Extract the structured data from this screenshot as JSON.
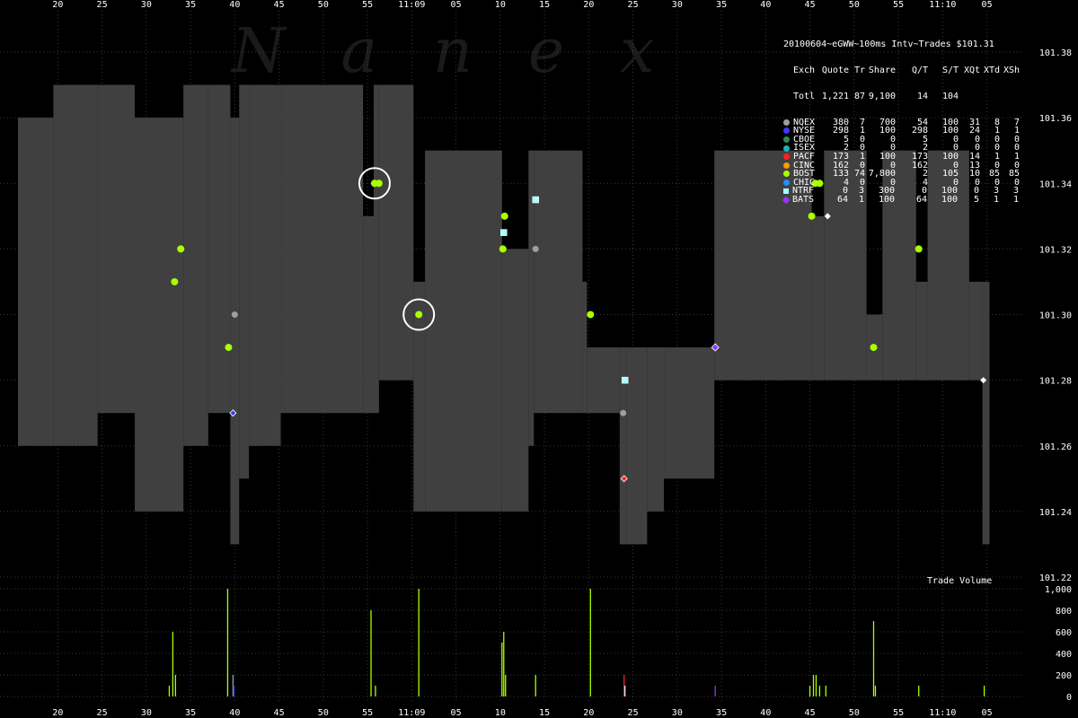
{
  "watermark": "Nanex",
  "legend": {
    "title": "20100604~eGWW~100ms Intv~Trades $101.31",
    "header": [
      "Exch",
      "Quote",
      "Tr",
      "Share",
      "Q/T",
      "S/T",
      "XQt",
      "XTd",
      "XSh"
    ],
    "total": [
      "Totl",
      "1,221",
      "87",
      "9,100",
      "14",
      "104",
      "",
      "",
      ""
    ],
    "rows": [
      {
        "exch": "NQEX",
        "quote": "380",
        "tr": "7",
        "share": "700",
        "qt": "54",
        "st": "100",
        "xqt": "31",
        "xtd": "8",
        "xsh": "7",
        "color": "#9e9e9e",
        "marker": "dot"
      },
      {
        "exch": "NYSE",
        "quote": "298",
        "tr": "1",
        "share": "100",
        "qt": "298",
        "st": "100",
        "xqt": "24",
        "xtd": "1",
        "xsh": "1",
        "color": "#3a3aff",
        "marker": "dot"
      },
      {
        "exch": "CBOE",
        "quote": "5",
        "tr": "0",
        "share": "0",
        "qt": "5",
        "st": "0",
        "xqt": "0",
        "xtd": "0",
        "xsh": "0",
        "color": "#2e8b57",
        "marker": "dot"
      },
      {
        "exch": "ISEX",
        "quote": "2",
        "tr": "0",
        "share": "0",
        "qt": "2",
        "st": "0",
        "xqt": "0",
        "xtd": "0",
        "xsh": "0",
        "color": "#20b2aa",
        "marker": "dot"
      },
      {
        "exch": "PACF",
        "quote": "173",
        "tr": "1",
        "share": "100",
        "qt": "173",
        "st": "100",
        "xqt": "14",
        "xtd": "1",
        "xsh": "1",
        "color": "#ff2020",
        "marker": "dot"
      },
      {
        "exch": "CINC",
        "quote": "162",
        "tr": "0",
        "share": "0",
        "qt": "162",
        "st": "0",
        "xqt": "13",
        "xtd": "0",
        "xsh": "0",
        "color": "#ff9900",
        "marker": "dot"
      },
      {
        "exch": "BOST",
        "quote": "133",
        "tr": "74",
        "share": "7,800",
        "qt": "2",
        "st": "105",
        "xqt": "10",
        "xtd": "85",
        "xsh": "85",
        "color": "#aaff00",
        "marker": "dot"
      },
      {
        "exch": "CHIC",
        "quote": "4",
        "tr": "0",
        "share": "0",
        "qt": "4",
        "st": "0",
        "xqt": "0",
        "xtd": "0",
        "xsh": "0",
        "color": "#1e90ff",
        "marker": "dot"
      },
      {
        "exch": "NTRF",
        "quote": "0",
        "tr": "3",
        "share": "300",
        "qt": "0",
        "st": "100",
        "xqt": "0",
        "xtd": "3",
        "xsh": "3",
        "color": "#aaffff",
        "marker": "square"
      },
      {
        "exch": "BATS",
        "quote": "64",
        "tr": "1",
        "share": "100",
        "qt": "64",
        "st": "100",
        "xqt": "5",
        "xtd": "1",
        "xsh": "1",
        "color": "#9933ff",
        "marker": "diamond"
      }
    ]
  },
  "volume_label": "Trade Volume",
  "colors": {
    "band": "#404040",
    "grid": "#3a3a3a",
    "bost": "#aaff00",
    "nqex": "#9e9e9e",
    "ntrf": "#aaffff",
    "bats": "#9933ff",
    "pacf": "#ff2020",
    "nyse": "#3a3aff",
    "white": "#ffffff"
  },
  "chart_data": [
    {
      "type": "area",
      "description_kind": "price",
      "x_unit": "seconds from 11:08:20",
      "x_ticks": [
        {
          "t": 0,
          "label": "20"
        },
        {
          "t": 5,
          "label": "25"
        },
        {
          "t": 10,
          "label": "30"
        },
        {
          "t": 15,
          "label": "35"
        },
        {
          "t": 20,
          "label": "40"
        },
        {
          "t": 25,
          "label": "45"
        },
        {
          "t": 30,
          "label": "50"
        },
        {
          "t": 35,
          "label": "55"
        },
        {
          "t": 40,
          "label": "11:09"
        },
        {
          "t": 45,
          "label": "05"
        },
        {
          "t": 50,
          "label": "10"
        },
        {
          "t": 55,
          "label": "15"
        },
        {
          "t": 60,
          "label": "20"
        },
        {
          "t": 65,
          "label": "25"
        },
        {
          "t": 70,
          "label": "30"
        },
        {
          "t": 75,
          "label": "35"
        },
        {
          "t": 80,
          "label": "40"
        },
        {
          "t": 85,
          "label": "45"
        },
        {
          "t": 90,
          "label": "50"
        },
        {
          "t": 95,
          "label": "55"
        },
        {
          "t": 100,
          "label": "11:10"
        },
        {
          "t": 105,
          "label": "05"
        }
      ],
      "x_range": [
        -4.5,
        106
      ],
      "y_ticks": [
        "101.22",
        "101.24",
        "101.26",
        "101.28",
        "101.30",
        "101.32",
        "101.34",
        "101.36",
        "101.38"
      ],
      "y_range": [
        101.22,
        101.38
      ],
      "band": [
        {
          "t0": -4.5,
          "t1": -0.5,
          "bid": 101.26,
          "ask": 101.36
        },
        {
          "t0": -0.5,
          "t1": 4.5,
          "bid": 101.26,
          "ask": 101.37
        },
        {
          "t0": 4.5,
          "t1": 8.7,
          "bid": 101.27,
          "ask": 101.37
        },
        {
          "t0": 8.7,
          "t1": 14.2,
          "bid": 101.24,
          "ask": 101.36
        },
        {
          "t0": 14.2,
          "t1": 17.0,
          "bid": 101.26,
          "ask": 101.37
        },
        {
          "t0": 17.0,
          "t1": 19.5,
          "bid": 101.27,
          "ask": 101.37
        },
        {
          "t0": 19.5,
          "t1": 20.5,
          "bid": 101.23,
          "ask": 101.36
        },
        {
          "t0": 20.5,
          "t1": 21.6,
          "bid": 101.25,
          "ask": 101.37
        },
        {
          "t0": 21.6,
          "t1": 25.2,
          "bid": 101.26,
          "ask": 101.37
        },
        {
          "t0": 25.2,
          "t1": 34.5,
          "bid": 101.27,
          "ask": 101.37
        },
        {
          "t0": 34.5,
          "t1": 35.7,
          "bid": 101.27,
          "ask": 101.33
        },
        {
          "t0": 35.7,
          "t1": 36.3,
          "bid": 101.27,
          "ask": 101.37
        },
        {
          "t0": 36.3,
          "t1": 40.2,
          "bid": 101.28,
          "ask": 101.37
        },
        {
          "t0": 40.2,
          "t1": 41.5,
          "bid": 101.24,
          "ask": 101.31
        },
        {
          "t0": 41.5,
          "t1": 50.2,
          "bid": 101.24,
          "ask": 101.35
        },
        {
          "t0": 50.2,
          "t1": 53.2,
          "bid": 101.24,
          "ask": 101.32
        },
        {
          "t0": 53.2,
          "t1": 53.8,
          "bid": 101.26,
          "ask": 101.35
        },
        {
          "t0": 53.8,
          "t1": 59.3,
          "bid": 101.27,
          "ask": 101.35
        },
        {
          "t0": 59.3,
          "t1": 59.8,
          "bid": 101.27,
          "ask": 101.31
        },
        {
          "t0": 59.8,
          "t1": 63.5,
          "bid": 101.27,
          "ask": 101.29
        },
        {
          "t0": 63.5,
          "t1": 64.3,
          "bid": 101.23,
          "ask": 101.29
        },
        {
          "t0": 64.3,
          "t1": 66.6,
          "bid": 101.23,
          "ask": 101.29
        },
        {
          "t0": 66.6,
          "t1": 68.5,
          "bid": 101.24,
          "ask": 101.29
        },
        {
          "t0": 68.5,
          "t1": 74.2,
          "bid": 101.25,
          "ask": 101.29
        },
        {
          "t0": 74.2,
          "t1": 85.2,
          "bid": 101.28,
          "ask": 101.35
        },
        {
          "t0": 85.2,
          "t1": 86.6,
          "bid": 101.28,
          "ask": 101.33
        },
        {
          "t0": 86.6,
          "t1": 91.4,
          "bid": 101.28,
          "ask": 101.35
        },
        {
          "t0": 91.4,
          "t1": 93.2,
          "bid": 101.28,
          "ask": 101.3
        },
        {
          "t0": 93.2,
          "t1": 97.0,
          "bid": 101.28,
          "ask": 101.35
        },
        {
          "t0": 97.0,
          "t1": 98.3,
          "bid": 101.28,
          "ask": 101.31
        },
        {
          "t0": 98.3,
          "t1": 103.0,
          "bid": 101.28,
          "ask": 101.35
        },
        {
          "t0": 103.0,
          "t1": 104.5,
          "bid": 101.28,
          "ask": 101.31
        },
        {
          "t0": 104.5,
          "t1": 105.3,
          "bid": 101.23,
          "ask": 101.31
        }
      ],
      "trades": [
        {
          "t": 13.2,
          "price": 101.31,
          "exch": "BOST"
        },
        {
          "t": 13.9,
          "price": 101.32,
          "exch": "BOST"
        },
        {
          "t": 19.3,
          "price": 101.29,
          "exch": "BOST"
        },
        {
          "t": 20.0,
          "price": 101.3,
          "exch": "NQEX"
        },
        {
          "t": 19.8,
          "price": 101.27,
          "exch": "NYSE"
        },
        {
          "t": 35.8,
          "price": 101.34,
          "exch": "BOST",
          "circled": true
        },
        {
          "t": 36.3,
          "price": 101.34,
          "exch": "BOST"
        },
        {
          "t": 40.8,
          "price": 101.3,
          "exch": "BOST",
          "circled": true
        },
        {
          "t": 50.5,
          "price": 101.33,
          "exch": "BOST"
        },
        {
          "t": 50.3,
          "price": 101.32,
          "exch": "BOST"
        },
        {
          "t": 50.4,
          "price": 101.325,
          "exch": "NTRF"
        },
        {
          "t": 54.0,
          "price": 101.335,
          "exch": "NTRF"
        },
        {
          "t": 54.0,
          "price": 101.32,
          "exch": "NQEX"
        },
        {
          "t": 60.2,
          "price": 101.3,
          "exch": "BOST"
        },
        {
          "t": 64.1,
          "price": 101.28,
          "exch": "NTRF"
        },
        {
          "t": 63.9,
          "price": 101.27,
          "exch": "NQEX"
        },
        {
          "t": 64.0,
          "price": 101.25,
          "exch": "PACF"
        },
        {
          "t": 74.3,
          "price": 101.29,
          "exch": "BATS"
        },
        {
          "t": 85.2,
          "price": 101.33,
          "exch": "BOST"
        },
        {
          "t": 85.6,
          "price": 101.34,
          "exch": "BOST"
        },
        {
          "t": 86.1,
          "price": 101.34,
          "exch": "BOST"
        },
        {
          "t": 87.0,
          "price": 101.33,
          "exch": "white"
        },
        {
          "t": 92.2,
          "price": 101.29,
          "exch": "BOST"
        },
        {
          "t": 97.3,
          "price": 101.32,
          "exch": "BOST"
        },
        {
          "t": 104.6,
          "price": 101.28,
          "exch": "white"
        }
      ]
    },
    {
      "type": "bar",
      "description_kind": "volume",
      "ylabel": "Trade Volume",
      "y_ticks": [
        "0",
        "200",
        "400",
        "600",
        "800",
        "1,000"
      ],
      "y_range": [
        0,
        1000
      ],
      "bars": [
        {
          "t": 12.6,
          "v": 100,
          "exch": "BOST"
        },
        {
          "t": 13.0,
          "v": 600,
          "exch": "BOST"
        },
        {
          "t": 13.3,
          "v": 200,
          "exch": "BOST"
        },
        {
          "t": 19.2,
          "v": 1000,
          "exch": "BOST"
        },
        {
          "t": 19.8,
          "v": 200,
          "exch": "NQEX"
        },
        {
          "t": 19.9,
          "v": 100,
          "exch": "NYSE"
        },
        {
          "t": 35.4,
          "v": 800,
          "exch": "BOST"
        },
        {
          "t": 35.9,
          "v": 100,
          "exch": "BOST"
        },
        {
          "t": 40.8,
          "v": 1000,
          "exch": "BOST"
        },
        {
          "t": 50.2,
          "v": 500,
          "exch": "BOST"
        },
        {
          "t": 50.4,
          "v": 600,
          "exch": "BOST"
        },
        {
          "t": 50.6,
          "v": 200,
          "exch": "BOST"
        },
        {
          "t": 54.0,
          "v": 200,
          "exch": "BOST"
        },
        {
          "t": 60.2,
          "v": 1000,
          "exch": "BOST"
        },
        {
          "t": 64.0,
          "v": 200,
          "exch": "PACF"
        },
        {
          "t": 64.1,
          "v": 100,
          "exch": "NTRF"
        },
        {
          "t": 74.3,
          "v": 100,
          "exch": "BATS"
        },
        {
          "t": 85.0,
          "v": 100,
          "exch": "BOST"
        },
        {
          "t": 85.4,
          "v": 200,
          "exch": "BOST"
        },
        {
          "t": 85.7,
          "v": 200,
          "exch": "BOST"
        },
        {
          "t": 86.1,
          "v": 100,
          "exch": "BOST"
        },
        {
          "t": 86.8,
          "v": 100,
          "exch": "BOST"
        },
        {
          "t": 92.2,
          "v": 700,
          "exch": "BOST"
        },
        {
          "t": 92.4,
          "v": 100,
          "exch": "BOST"
        },
        {
          "t": 97.3,
          "v": 100,
          "exch": "BOST"
        },
        {
          "t": 104.7,
          "v": 100,
          "exch": "BOST"
        }
      ]
    }
  ]
}
